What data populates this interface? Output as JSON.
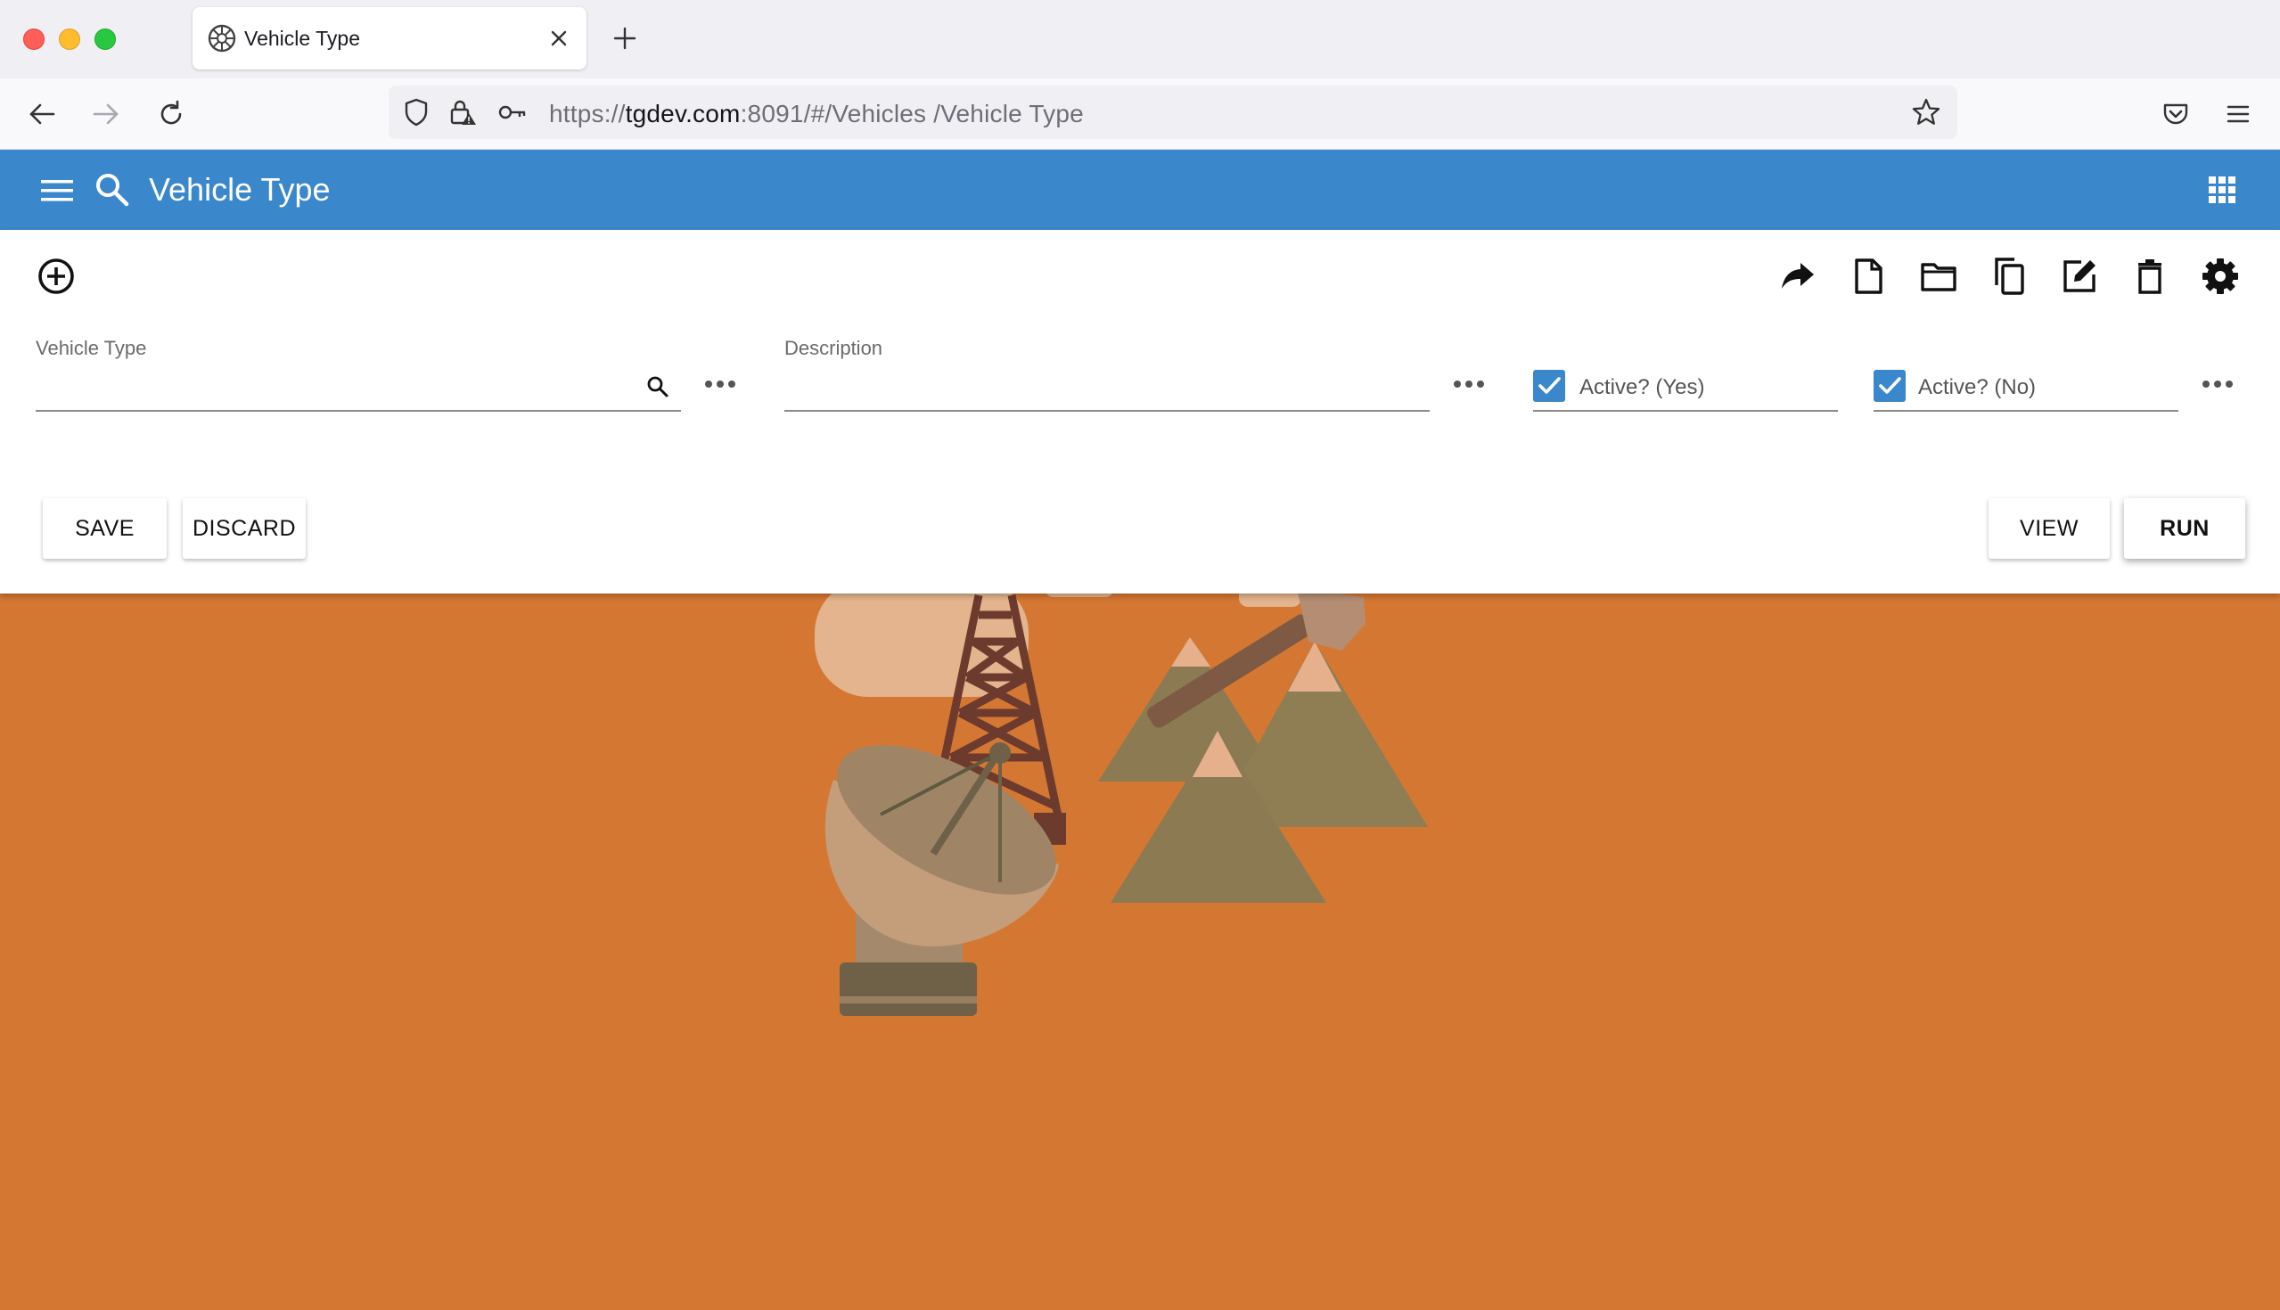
{
  "browser": {
    "tab": {
      "title": "Vehicle Type"
    },
    "url": {
      "scheme": "https://",
      "host": "tgdev.com",
      "rest": ":8091/#/Vehicles /Vehicle Type"
    }
  },
  "app": {
    "title": "Vehicle Type",
    "header_color": "#3a87cb",
    "background_color": "#d47733"
  },
  "toolbar": {
    "icons": [
      "add-circle-icon",
      "share-icon",
      "new-document-icon",
      "open-folder-icon",
      "copy-icon",
      "edit-icon",
      "delete-icon",
      "settings-icon"
    ]
  },
  "form": {
    "vehicle_type": {
      "label": "Vehicle Type",
      "value": ""
    },
    "description": {
      "label": "Description",
      "value": ""
    },
    "active_yes": {
      "label": "Active? (Yes)",
      "checked": true
    },
    "active_no": {
      "label": "Active? (No)",
      "checked": true
    }
  },
  "buttons": {
    "save": "SAVE",
    "discard": "DISCARD",
    "view": "VIEW",
    "run": "RUN"
  }
}
